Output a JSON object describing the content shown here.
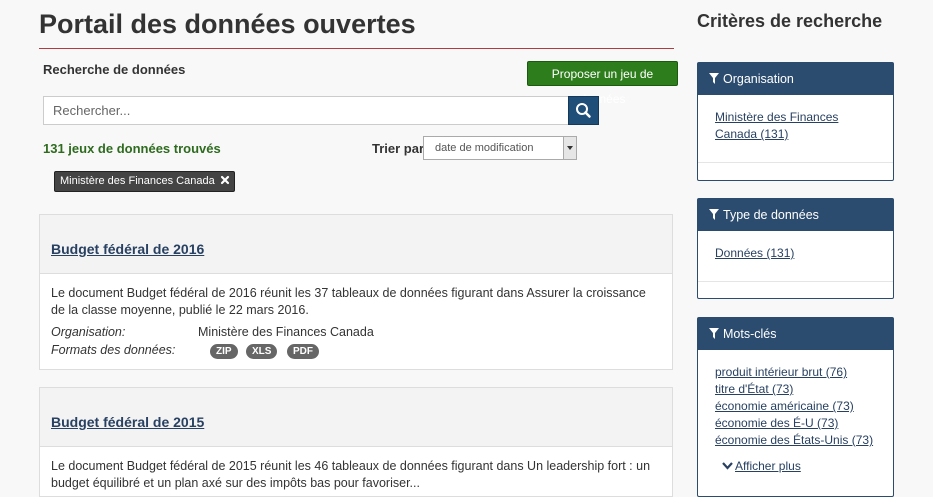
{
  "header": {
    "title": "Portail des données ouvertes"
  },
  "search": {
    "heading": "Recherche de données",
    "propose_label": "Proposer un jeu de données",
    "placeholder": "Rechercher...",
    "results_count": "131 jeux de données trouvés",
    "sort_label": "Trier par",
    "sort_value": "date de modification",
    "active_filter": "Ministère des Finances Canada"
  },
  "results": [
    {
      "title": "Budget fédéral de 2016",
      "description": "Le document Budget fédéral de 2016 réunit les 37 tableaux de données figurant dans Assurer la croissance de la classe moyenne, publié le 22 mars 2016.",
      "org_label": "Organisation:",
      "org_value": "Ministère des Finances Canada",
      "formats_label": "Formats des données:",
      "formats": [
        "ZIP",
        "XLS",
        "PDF"
      ]
    },
    {
      "title": "Budget fédéral de 2015",
      "description": "Le document Budget fédéral de 2015 réunit les 46 tableaux de données figurant dans Un leadership fort : un budget équilibré et un plan axé sur des impôts bas pour favoriser..."
    }
  ],
  "sidebar": {
    "title": "Critères de recherche",
    "panels": [
      {
        "heading": "Organisation",
        "links": [
          "Ministère des Finances Canada (131)"
        ]
      },
      {
        "heading": "Type de données",
        "links": [
          "Données (131)"
        ]
      },
      {
        "heading": "Mots-clés",
        "links": [
          "produit intérieur brut (76)",
          "titre d'État (73)",
          "économie américaine (73)",
          "économie des É-U (73)",
          "économie des États-Unis (73)"
        ],
        "more_label": "Afficher plus"
      }
    ]
  }
}
